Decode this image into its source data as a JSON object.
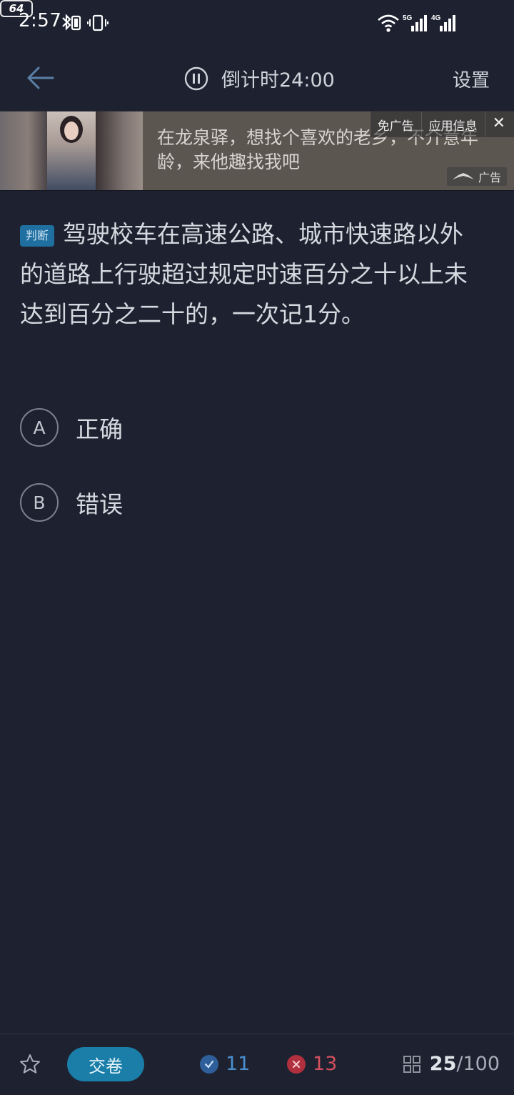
{
  "status_bar": {
    "time": "2:57",
    "battery": "64",
    "network_1": "5G",
    "network_2": "4G"
  },
  "header": {
    "timer_text": "倒计时24:00",
    "settings_label": "设置"
  },
  "ad": {
    "text": "在龙泉驿，想找个喜欢的老乡，不介意年龄，来他趣找我吧",
    "remove_ad_label": "免广告",
    "app_info_label": "应用信息",
    "badge_label": "广告"
  },
  "question": {
    "type_tag": "判断",
    "text": "驾驶校车在高速公路、城市快速路以外的道路上行驶超过规定时速百分之十以上未达到百分之二十的，一次记1分。"
  },
  "options": [
    {
      "letter": "A",
      "label": "正确"
    },
    {
      "letter": "B",
      "label": "错误"
    }
  ],
  "bottom_bar": {
    "submit_label": "交卷",
    "correct_count": "11",
    "wrong_count": "13",
    "current": "25",
    "total": "/100"
  },
  "colors": {
    "background": "#1e2230",
    "accent": "#1a7ea8",
    "correct": "#4a90d0",
    "wrong": "#d4505e"
  }
}
